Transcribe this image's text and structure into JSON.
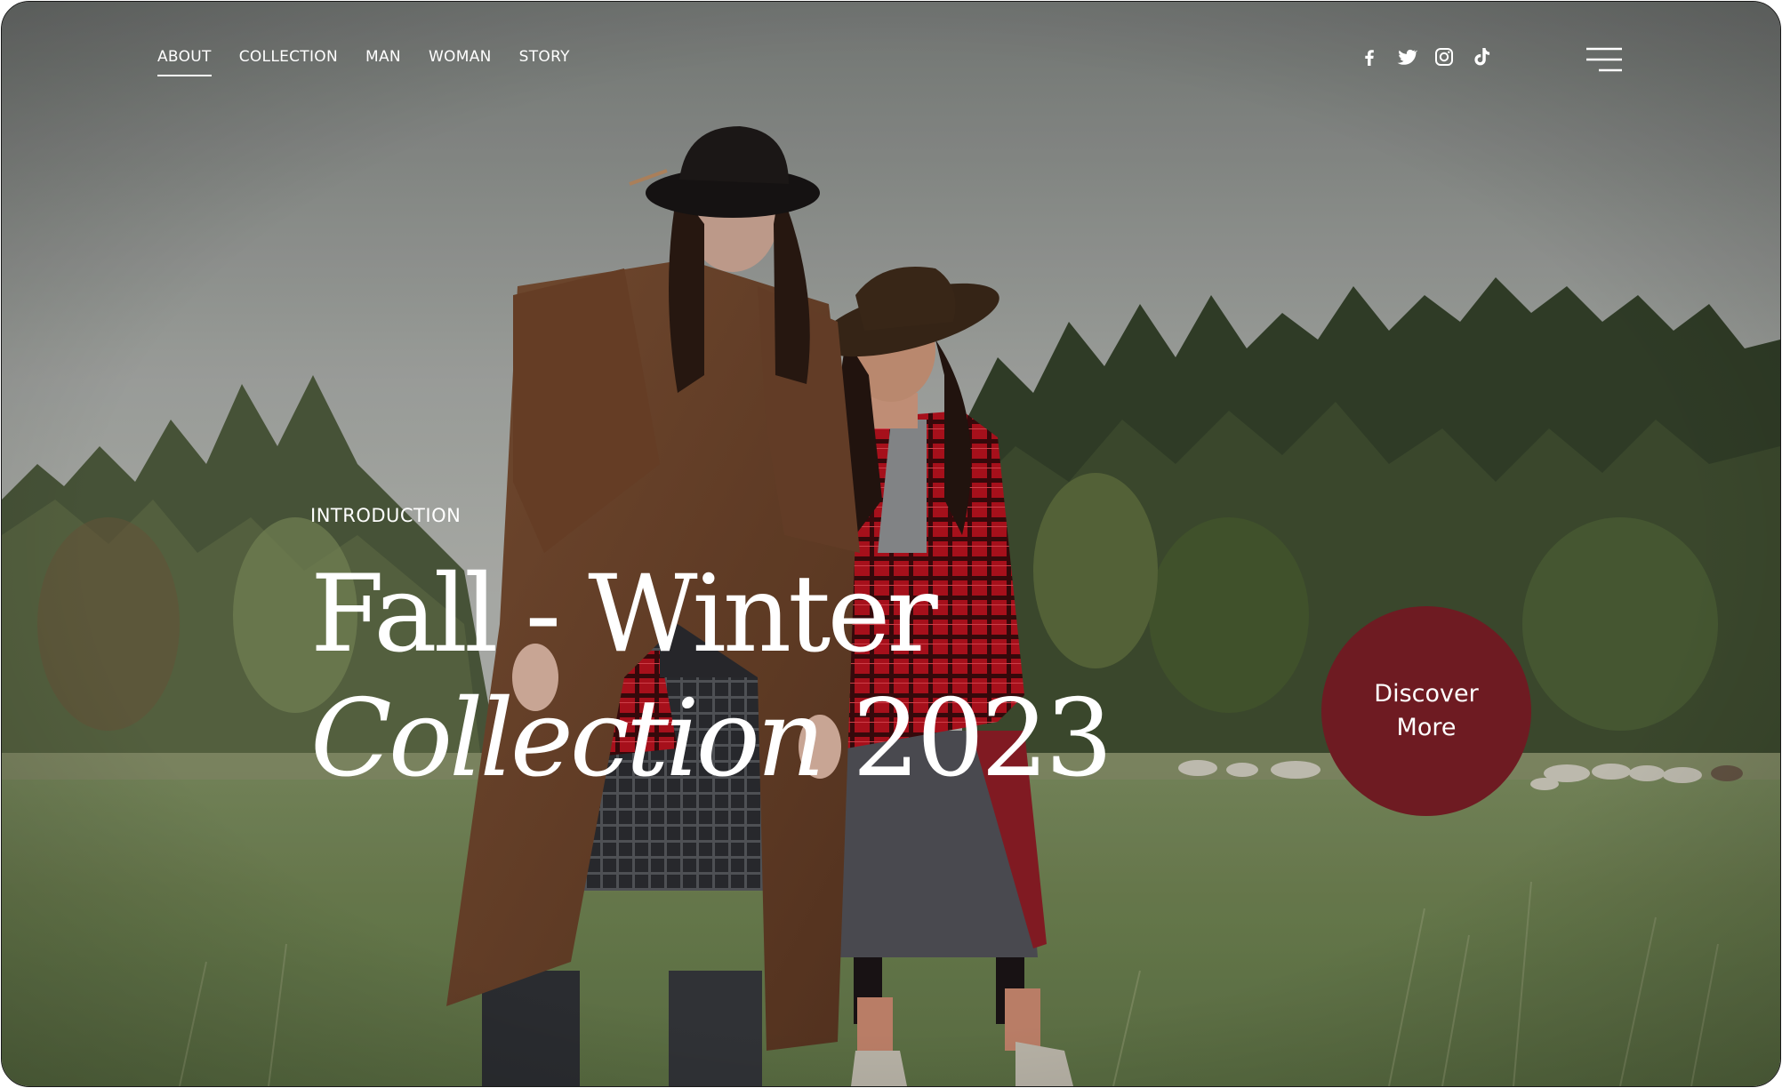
{
  "nav": {
    "items": [
      {
        "label": "ABOUT",
        "active": true
      },
      {
        "label": "COLLECTION",
        "active": false
      },
      {
        "label": "MAN",
        "active": false
      },
      {
        "label": "WOMAN",
        "active": false
      },
      {
        "label": "STORY",
        "active": false
      }
    ]
  },
  "socials": [
    "facebook-icon",
    "twitter-icon",
    "instagram-icon",
    "tiktok-icon"
  ],
  "menu_icon": "hamburger-menu-icon",
  "hero": {
    "eyebrow": "INTRODUCTION",
    "title_line1": "Fall - Winter",
    "title_line2_italic": "Collection",
    "title_line2_year": "2023",
    "cta": "Discover More"
  },
  "colors": {
    "accent": "#6e1b22",
    "text": "#ffffff",
    "sky": "#9ea19c",
    "forest": "#3c4a30",
    "meadow": "#6f8252"
  },
  "photo": {
    "description_icon": "fashion-photo-two-models-in-field"
  }
}
